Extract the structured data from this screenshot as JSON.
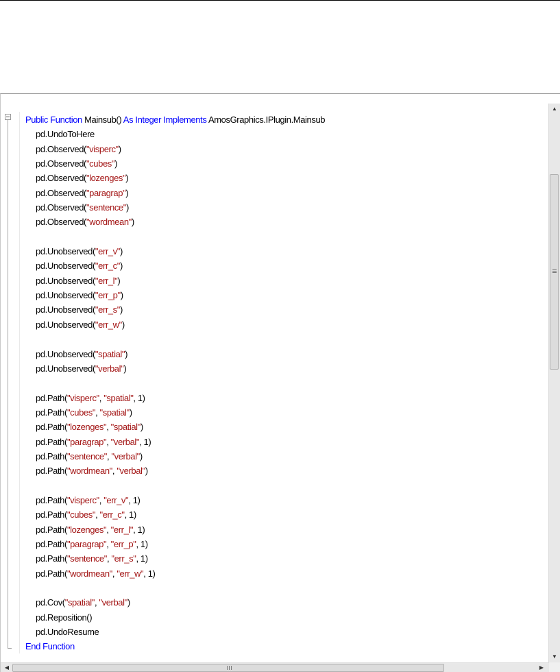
{
  "editor": {
    "lines": [
      [
        {
          "t": "Public Function ",
          "c": "kw"
        },
        {
          "t": "Mainsub() ",
          "c": ""
        },
        {
          "t": "As Integer Implements ",
          "c": "kw"
        },
        {
          "t": "AmosGraphics.IPlugin.Mainsub",
          "c": ""
        }
      ],
      [
        {
          "t": "pd.UndoToHere",
          "c": ""
        }
      ],
      [
        {
          "t": "pd.Observed(",
          "c": ""
        },
        {
          "t": "\"visperc\"",
          "c": "str"
        },
        {
          "t": ")",
          "c": ""
        }
      ],
      [
        {
          "t": "pd.Observed(",
          "c": ""
        },
        {
          "t": "\"cubes\"",
          "c": "str"
        },
        {
          "t": ")",
          "c": ""
        }
      ],
      [
        {
          "t": "pd.Observed(",
          "c": ""
        },
        {
          "t": "\"lozenges\"",
          "c": "str"
        },
        {
          "t": ")",
          "c": ""
        }
      ],
      [
        {
          "t": "pd.Observed(",
          "c": ""
        },
        {
          "t": "\"paragrap\"",
          "c": "str"
        },
        {
          "t": ")",
          "c": ""
        }
      ],
      [
        {
          "t": "pd.Observed(",
          "c": ""
        },
        {
          "t": "\"sentence\"",
          "c": "str"
        },
        {
          "t": ")",
          "c": ""
        }
      ],
      [
        {
          "t": "pd.Observed(",
          "c": ""
        },
        {
          "t": "\"wordmean\"",
          "c": "str"
        },
        {
          "t": ")",
          "c": ""
        }
      ],
      [],
      [
        {
          "t": "pd.Unobserved(",
          "c": ""
        },
        {
          "t": "\"err_v\"",
          "c": "str"
        },
        {
          "t": ")",
          "c": ""
        }
      ],
      [
        {
          "t": "pd.Unobserved(",
          "c": ""
        },
        {
          "t": "\"err_c\"",
          "c": "str"
        },
        {
          "t": ")",
          "c": ""
        }
      ],
      [
        {
          "t": "pd.Unobserved(",
          "c": ""
        },
        {
          "t": "\"err_l\"",
          "c": "str"
        },
        {
          "t": ")",
          "c": ""
        }
      ],
      [
        {
          "t": "pd.Unobserved(",
          "c": ""
        },
        {
          "t": "\"err_p\"",
          "c": "str"
        },
        {
          "t": ")",
          "c": ""
        }
      ],
      [
        {
          "t": "pd.Unobserved(",
          "c": ""
        },
        {
          "t": "\"err_s\"",
          "c": "str"
        },
        {
          "t": ")",
          "c": ""
        }
      ],
      [
        {
          "t": "pd.Unobserved(",
          "c": ""
        },
        {
          "t": "\"err_w\"",
          "c": "str"
        },
        {
          "t": ")",
          "c": ""
        }
      ],
      [],
      [
        {
          "t": "pd.Unobserved(",
          "c": ""
        },
        {
          "t": "\"spatial\"",
          "c": "str"
        },
        {
          "t": ")",
          "c": ""
        }
      ],
      [
        {
          "t": "pd.Unobserved(",
          "c": ""
        },
        {
          "t": "\"verbal\"",
          "c": "str"
        },
        {
          "t": ")",
          "c": ""
        }
      ],
      [],
      [
        {
          "t": "pd.Path(",
          "c": ""
        },
        {
          "t": "\"visperc\"",
          "c": "str"
        },
        {
          "t": ", ",
          "c": ""
        },
        {
          "t": "\"spatial\"",
          "c": "str"
        },
        {
          "t": ", 1)",
          "c": ""
        }
      ],
      [
        {
          "t": "pd.Path(",
          "c": ""
        },
        {
          "t": "\"cubes\"",
          "c": "str"
        },
        {
          "t": ", ",
          "c": ""
        },
        {
          "t": "\"spatial\"",
          "c": "str"
        },
        {
          "t": ")",
          "c": ""
        }
      ],
      [
        {
          "t": "pd.Path(",
          "c": ""
        },
        {
          "t": "\"lozenges\"",
          "c": "str"
        },
        {
          "t": ", ",
          "c": ""
        },
        {
          "t": "\"spatial\"",
          "c": "str"
        },
        {
          "t": ")",
          "c": ""
        }
      ],
      [
        {
          "t": "pd.Path(",
          "c": ""
        },
        {
          "t": "\"paragrap\"",
          "c": "str"
        },
        {
          "t": ", ",
          "c": ""
        },
        {
          "t": "\"verbal\"",
          "c": "str"
        },
        {
          "t": ", 1)",
          "c": ""
        }
      ],
      [
        {
          "t": "pd.Path(",
          "c": ""
        },
        {
          "t": "\"sentence\"",
          "c": "str"
        },
        {
          "t": ", ",
          "c": ""
        },
        {
          "t": "\"verbal\"",
          "c": "str"
        },
        {
          "t": ")",
          "c": ""
        }
      ],
      [
        {
          "t": "pd.Path(",
          "c": ""
        },
        {
          "t": "\"wordmean\"",
          "c": "str"
        },
        {
          "t": ", ",
          "c": ""
        },
        {
          "t": "\"verbal\"",
          "c": "str"
        },
        {
          "t": ")",
          "c": ""
        }
      ],
      [],
      [
        {
          "t": "pd.Path(",
          "c": ""
        },
        {
          "t": "\"visperc\"",
          "c": "str"
        },
        {
          "t": ", ",
          "c": ""
        },
        {
          "t": "\"err_v\"",
          "c": "str"
        },
        {
          "t": ", 1)",
          "c": ""
        }
      ],
      [
        {
          "t": "pd.Path(",
          "c": ""
        },
        {
          "t": "\"cubes\"",
          "c": "str"
        },
        {
          "t": ", ",
          "c": ""
        },
        {
          "t": "\"err_c\"",
          "c": "str"
        },
        {
          "t": ", 1)",
          "c": ""
        }
      ],
      [
        {
          "t": "pd.Path(",
          "c": ""
        },
        {
          "t": "\"lozenges\"",
          "c": "str"
        },
        {
          "t": ", ",
          "c": ""
        },
        {
          "t": "\"err_l\"",
          "c": "str"
        },
        {
          "t": ", 1)",
          "c": ""
        }
      ],
      [
        {
          "t": "pd.Path(",
          "c": ""
        },
        {
          "t": "\"paragrap\"",
          "c": "str"
        },
        {
          "t": ", ",
          "c": ""
        },
        {
          "t": "\"err_p\"",
          "c": "str"
        },
        {
          "t": ", 1)",
          "c": ""
        }
      ],
      [
        {
          "t": "pd.Path(",
          "c": ""
        },
        {
          "t": "\"sentence\"",
          "c": "str"
        },
        {
          "t": ", ",
          "c": ""
        },
        {
          "t": "\"err_s\"",
          "c": "str"
        },
        {
          "t": ", 1)",
          "c": ""
        }
      ],
      [
        {
          "t": "pd.Path(",
          "c": ""
        },
        {
          "t": "\"wordmean\"",
          "c": "str"
        },
        {
          "t": ", ",
          "c": ""
        },
        {
          "t": "\"err_w\"",
          "c": "str"
        },
        {
          "t": ", 1)",
          "c": ""
        }
      ],
      [],
      [
        {
          "t": "pd.Cov(",
          "c": ""
        },
        {
          "t": "\"spatial\"",
          "c": "str"
        },
        {
          "t": ", ",
          "c": ""
        },
        {
          "t": "\"verbal\"",
          "c": "str"
        },
        {
          "t": ")",
          "c": ""
        }
      ],
      [
        {
          "t": "pd.Reposition()",
          "c": ""
        }
      ],
      [
        {
          "t": "pd.UndoResume",
          "c": ""
        }
      ],
      [
        {
          "t": "End Function",
          "c": "kw"
        }
      ]
    ],
    "flush_lines": [
      0,
      36
    ]
  },
  "colors": {
    "keyword": "#0000ff",
    "string": "#a31515",
    "text": "#000000"
  },
  "scrollbars": {
    "vertical": {
      "up_icon": "triangle-up-icon",
      "down_icon": "triangle-down-icon",
      "thumb_grip_icon": "grip-lines-icon"
    },
    "horizontal": {
      "left_icon": "triangle-left-icon",
      "right_icon": "triangle-right-icon",
      "thumb_grip_icon": "grip-lines-icon"
    }
  }
}
